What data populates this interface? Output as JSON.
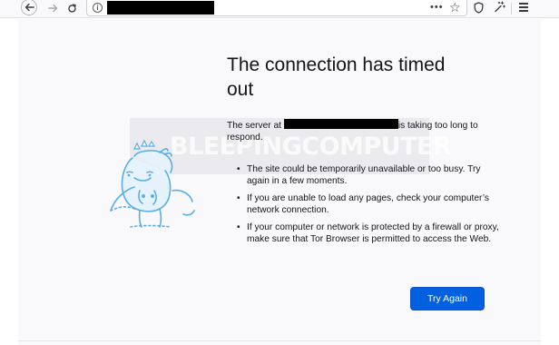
{
  "toolbar": {
    "back_icon": "arrow-left-icon",
    "forward_icon": "arrow-right-icon",
    "reload_icon": "reload-icon",
    "url_info_icon": "info-icon",
    "url_info_glyph": "i",
    "url_redacted": true,
    "more_glyph": "•••",
    "bookmark_glyph": "☆",
    "shield_icon": "shield-icon",
    "extension_icon": "wand-icon",
    "menu_icon": "hamburger-menu-icon"
  },
  "error_page": {
    "title": "The connection has timed out",
    "desc_prefix": "The server at ",
    "desc_suffix": "is taking too long to respond.",
    "bullets": [
      "The site could be temporarily unavailable or too busy. Try again in a few moments.",
      "If you are unable to load any pages, check your computer’s network connection.",
      "If your computer or network is protected by a firewall or proxy, make sure that Tor Browser is permitted to access the Web."
    ],
    "button_label": "Try Again",
    "illustration": "dinosaur-illustration"
  },
  "watermark": {
    "text": "BLEEPINGCOMPUTER"
  },
  "colors": {
    "accent": "#0060df",
    "page_bg": "#f9f9fb",
    "text": "#15141a"
  }
}
